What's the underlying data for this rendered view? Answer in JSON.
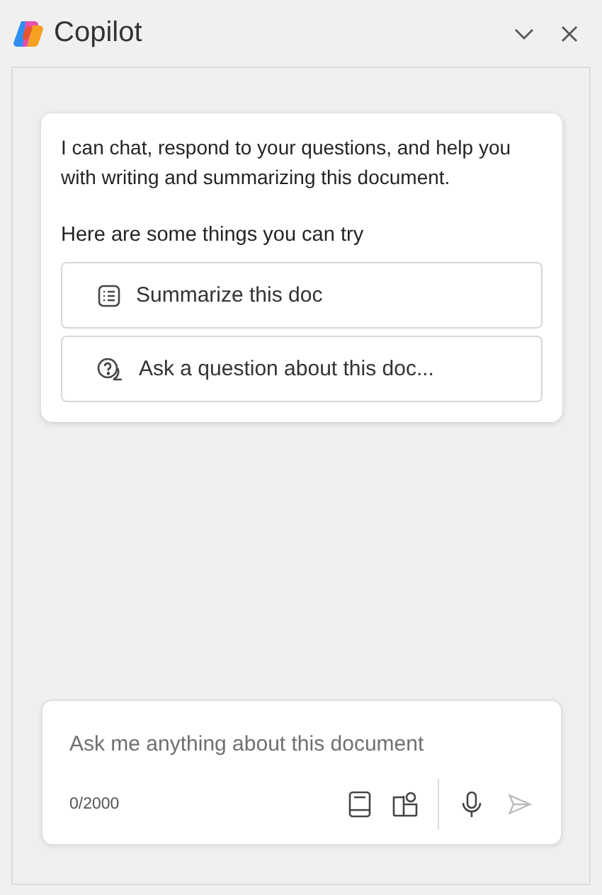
{
  "header": {
    "title": "Copilot"
  },
  "intro": {
    "message": "I can chat, respond to your questions, and help you with writing and summarizing this document.",
    "prompt_heading": "Here are some things you can try",
    "suggestions": [
      {
        "kind": "summary",
        "label": "Summarize this doc"
      },
      {
        "kind": "question",
        "label": "Ask a question about this doc..."
      }
    ]
  },
  "composer": {
    "placeholder": "Ask me anything about this document",
    "counter": "0/2000",
    "send_disabled": true
  }
}
